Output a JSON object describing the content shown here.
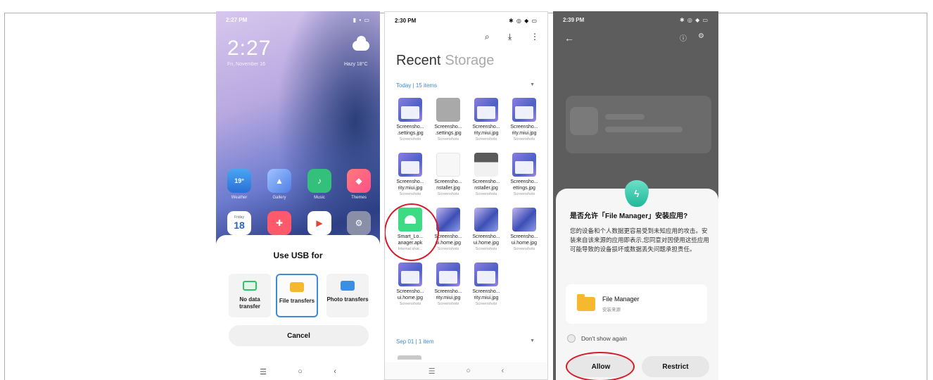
{
  "phone1": {
    "status_time": "2:27 PM",
    "clock": "2:27",
    "date": "Fri, November 16",
    "weather": "Hazy  18°C",
    "apps": [
      {
        "label": "Weather",
        "glyph": "19°"
      },
      {
        "label": "Gallery",
        "glyph": ""
      },
      {
        "label": "Music",
        "glyph": ""
      },
      {
        "label": "Themes",
        "glyph": ""
      },
      {
        "label": "",
        "glyph": "18"
      },
      {
        "label": "",
        "glyph": ""
      },
      {
        "label": "",
        "glyph": ""
      },
      {
        "label": "",
        "glyph": ""
      }
    ],
    "calendar_day": "Friday",
    "usb_sheet": {
      "title": "Use USB for",
      "options": [
        {
          "label": "No data transfer",
          "icon": "battery-icon"
        },
        {
          "label": "File transfers",
          "icon": "folder-icon",
          "selected": true
        },
        {
          "label": "Photo transfers",
          "icon": "photo-icon"
        }
      ],
      "cancel": "Cancel"
    },
    "nav": {
      "menu": "☰",
      "home": "○",
      "back": "‹"
    }
  },
  "phone2": {
    "status_time": "2:30 PM",
    "tabs": {
      "active": "Recent",
      "other": "Storage"
    },
    "section1": "Today  |  15 items",
    "section2": "Sep 01  |  1 item",
    "files": [
      {
        "name": "Screensho...",
        "name2": ".settings.jpg",
        "sub": "Screenshots",
        "kind": "shot"
      },
      {
        "name": "Screensho...",
        "name2": ".settings.jpg",
        "sub": "Screenshots",
        "kind": "gray"
      },
      {
        "name": "Screensho...",
        "name2": "rity.miui.jpg",
        "sub": "Screenshots",
        "kind": "shot"
      },
      {
        "name": "Screensho...",
        "name2": "rity.miui.jpg",
        "sub": "Screenshots",
        "kind": "shot"
      },
      {
        "name": "Screensho...",
        "name2": "rity.miui.jpg",
        "sub": "Screenshots",
        "kind": "shot"
      },
      {
        "name": "Screensho...",
        "name2": "nstaller.jpg",
        "sub": "Screenshots",
        "kind": "white"
      },
      {
        "name": "Screensho...",
        "name2": "nstaller.jpg",
        "sub": "Screenshots",
        "kind": "dark"
      },
      {
        "name": "Screensho...",
        "name2": "ettings.jpg",
        "sub": "Screenshots",
        "kind": "shot"
      },
      {
        "name": "Smart_Lo...",
        "name2": "anager.apk",
        "sub": "Internal shar...",
        "kind": "apk"
      },
      {
        "name": "Screensho...",
        "name2": "ui.home.jpg",
        "sub": "Screenshots",
        "kind": "wall"
      },
      {
        "name": "Screensho...",
        "name2": "ui.home.jpg",
        "sub": "Screenshots",
        "kind": "wall"
      },
      {
        "name": "Screensho...",
        "name2": "ui.home.jpg",
        "sub": "Screenshots",
        "kind": "wall"
      },
      {
        "name": "Screensho...",
        "name2": "ui.home.jpg",
        "sub": "Screenshots",
        "kind": "shot"
      },
      {
        "name": "Screensho...",
        "name2": "rity.miui.jpg",
        "sub": "Screenshots",
        "kind": "shot"
      },
      {
        "name": "Screensho...",
        "name2": "rity.miui.jpg",
        "sub": "Screenshots",
        "kind": "shot"
      }
    ],
    "nav": {
      "menu": "☰",
      "home": "○",
      "back": "‹"
    }
  },
  "phone3": {
    "status_time": "2:39 PM",
    "dialog": {
      "title": "是否允许「File Manager」安装应用?",
      "body": "您的设备和个人数据更容易受到未知应用的攻击。安装来自该来源的应用即表示,您同意对因使用这些应用可能导致的设备损坏或数据丢失问题承担责任。",
      "app_name": "File Manager",
      "app_source": "安装来源",
      "checkbox_label": "Don't show again",
      "allow": "Allow",
      "restrict": "Restrict"
    }
  },
  "colors": {
    "highlight_circle": "#d81b2a",
    "selected_border": "#3a8dd6",
    "section_blue": "#3a8dd6"
  }
}
